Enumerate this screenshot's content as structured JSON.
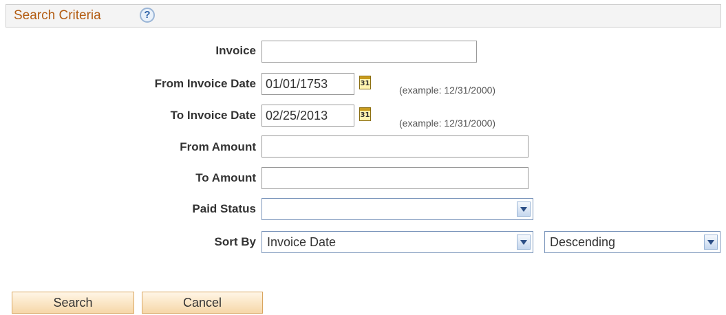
{
  "header": {
    "title": "Search Criteria",
    "help_icon": "?"
  },
  "form": {
    "invoice": {
      "label": "Invoice",
      "value": ""
    },
    "from_invoice_date": {
      "label": "From Invoice Date",
      "value": "01/01/1753",
      "hint": "(example: 12/31/2000)",
      "calendar_icon": "31"
    },
    "to_invoice_date": {
      "label": "To Invoice Date",
      "value": "02/25/2013",
      "hint": "(example: 12/31/2000)",
      "calendar_icon": "31"
    },
    "from_amount": {
      "label": "From Amount",
      "value": ""
    },
    "to_amount": {
      "label": "To Amount",
      "value": ""
    },
    "paid_status": {
      "label": "Paid Status",
      "value": ""
    },
    "sort_by": {
      "label": "Sort By",
      "field": "Invoice Date",
      "order": "Descending"
    }
  },
  "buttons": {
    "search": "Search",
    "cancel": "Cancel"
  },
  "colors": {
    "header_text": "#b35c12",
    "button_fill": "#f6d7a8",
    "select_border": "#7a95bb"
  }
}
